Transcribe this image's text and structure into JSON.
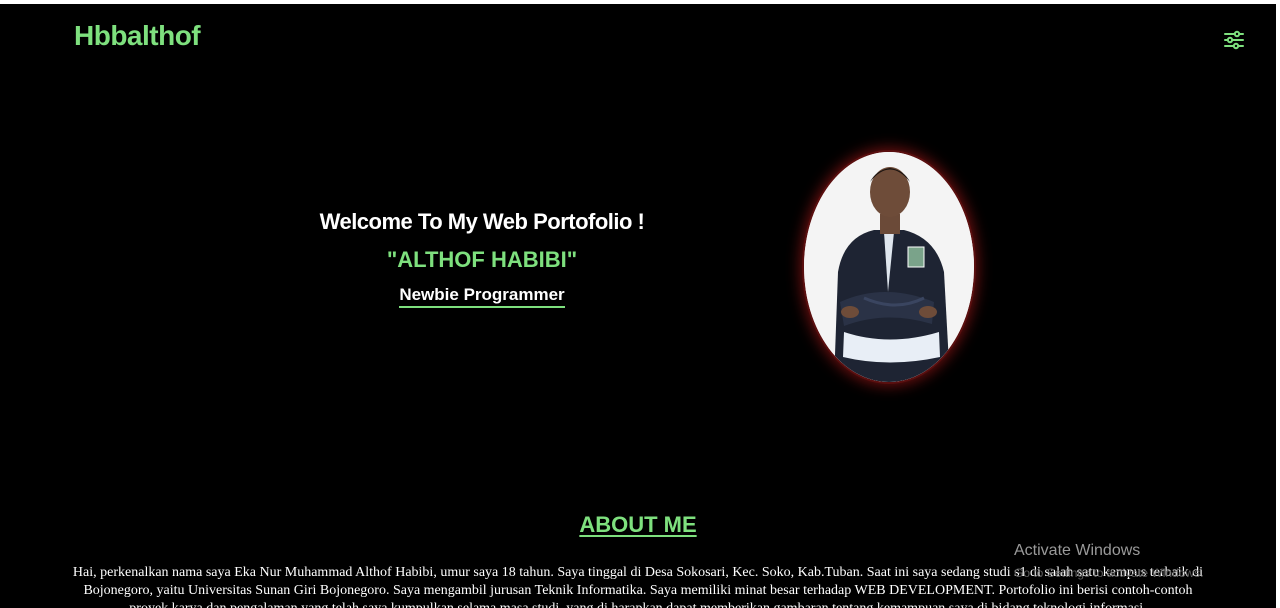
{
  "header": {
    "brand": "Hbbalthof",
    "menu_icon": "sliders-icon"
  },
  "hero": {
    "welcome": "Welcome To My Web Portofolio !",
    "name": "\"ALTHOF HABIBI\"",
    "role": "Newbie Programmer",
    "photo_border_color": "#6b1010"
  },
  "about": {
    "title": "ABOUT ME",
    "text": "Hai, perkenalkan nama saya Eka Nur Muhammad Althof Habibi, umur saya 18 tahun. Saya tinggal di Desa Sokosari, Kec. Soko, Kab.Tuban. Saat ini saya sedang studi s1 di salah satu kampus terbaik di Bojonegoro, yaitu Universitas Sunan Giri Bojonegoro. Saya mengambil jurusan Teknik Informatika. Saya memiliki minat besar terhadap WEB DEVELOPMENT. Portofolio ini berisi contoh-contoh proyek,karya,dan pengalaman yang telah saya kumpulkan selama masa studi, yang di harapkan dapat memberikan gambaran tentang kemampuan saya di bidang teknologi informasi."
  },
  "overlay": {
    "watermark_title": "Activate Windows",
    "watermark_sub": "Go to Settings to activate Windows."
  },
  "colors": {
    "accent": "#7ee07e",
    "background": "#000000",
    "text": "#ffffff"
  }
}
